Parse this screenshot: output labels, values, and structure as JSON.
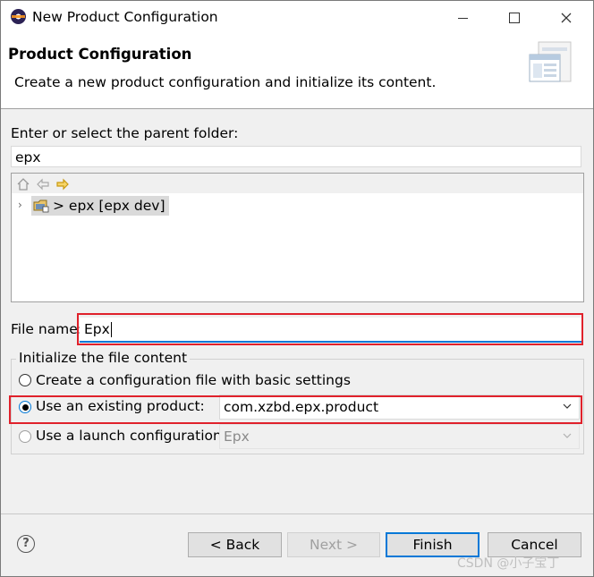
{
  "window": {
    "title": "New Product Configuration",
    "icon": "eclipse-icon"
  },
  "header": {
    "title": "Product Configuration",
    "description": "Create a new product configuration and initialize its content."
  },
  "parent_folder": {
    "label": "Enter or select the parent folder:",
    "value": "epx",
    "tree_items": [
      {
        "label": "> epx [epx dev]",
        "icon": "project-icon",
        "expanded": false,
        "selected": true
      }
    ]
  },
  "file_name": {
    "label": "File name:",
    "value": "Epx"
  },
  "init_group": {
    "title": "Initialize the file content",
    "options": [
      {
        "label": "Create a configuration file with basic settings",
        "selected": false,
        "enabled": true
      },
      {
        "label": "Use an existing product:",
        "selected": true,
        "enabled": true,
        "combo_value": "com.xzbd.epx.product"
      },
      {
        "label": "Use a launch configuration:",
        "selected": false,
        "enabled": false,
        "combo_value": "Epx"
      }
    ]
  },
  "buttons": {
    "back": "< Back",
    "next": "Next >",
    "finish": "Finish",
    "cancel": "Cancel"
  },
  "watermark": "CSDN @小子宝丁",
  "colors": {
    "highlight": "#e0212b",
    "focus": "#0078d7"
  }
}
